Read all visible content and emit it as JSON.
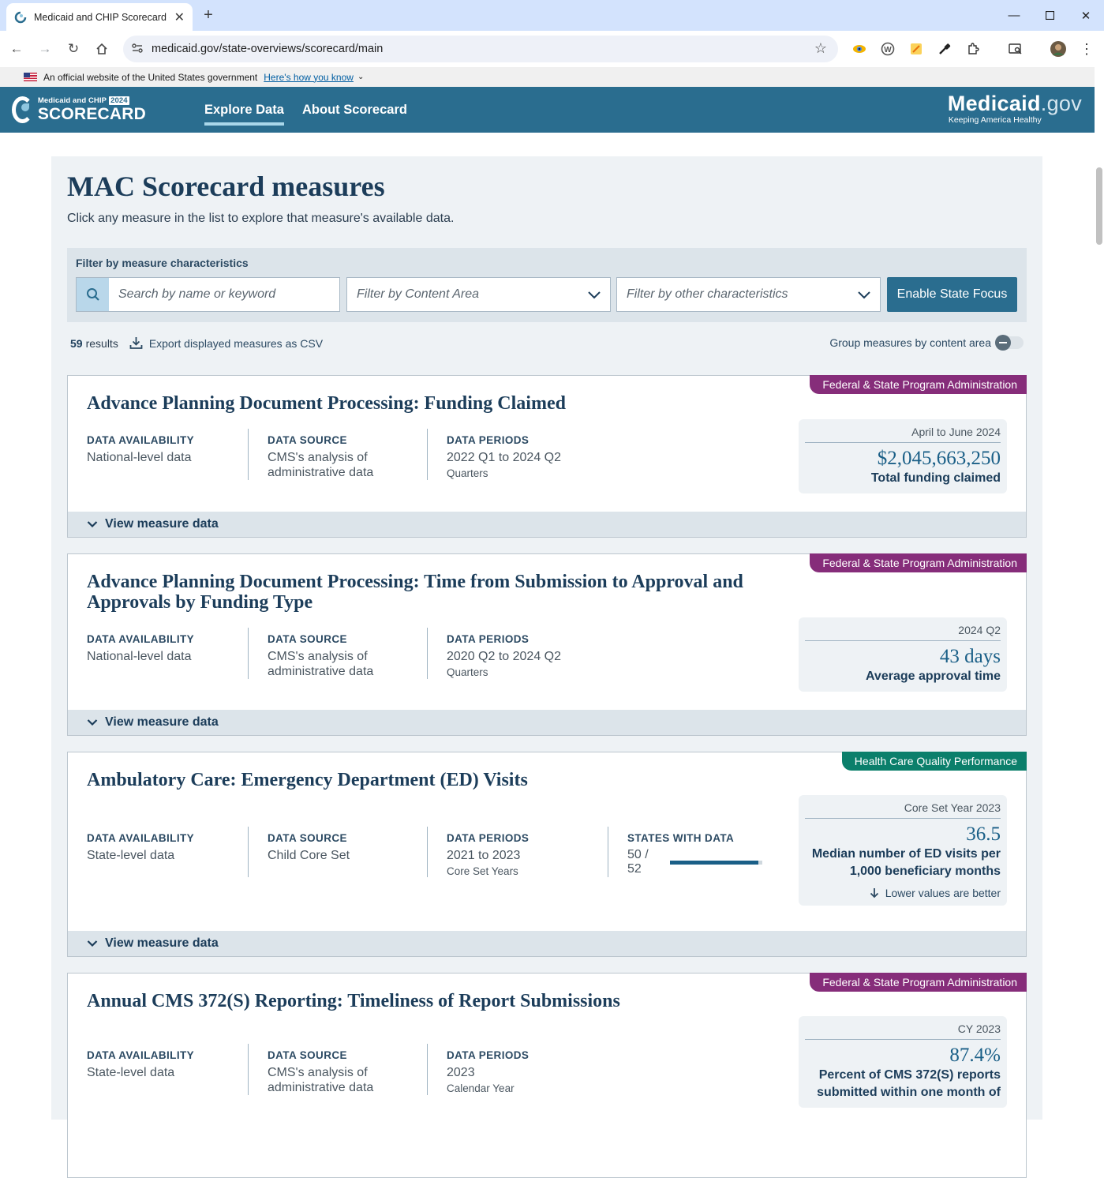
{
  "browser": {
    "tab_title": "Medicaid and CHIP Scorecard -",
    "url": "medicaid.gov/state-overviews/scorecard/main"
  },
  "gov_banner": {
    "text": "An official website of the United States government",
    "link": "Here's how you know"
  },
  "header": {
    "logo_small": "Medicaid and CHIP",
    "logo_year": "2024",
    "logo_big": "SCORECARD",
    "nav": [
      "Explore Data",
      "About Scorecard"
    ],
    "brand_main": "Medicaid",
    "brand_suffix": ".gov",
    "brand_tagline": "Keeping America Healthy"
  },
  "page": {
    "title": "MAC Scorecard measures",
    "subtitle": "Click any measure in the list to explore that measure's available data."
  },
  "filters": {
    "label": "Filter by measure characteristics",
    "search_placeholder": "Search by name or keyword",
    "content_area": "Filter by Content Area",
    "other": "Filter by other characteristics",
    "enable_button": "Enable State Focus"
  },
  "results": {
    "count": "59",
    "count_label": "results",
    "export": "Export displayed measures as CSV",
    "group_label": "Group measures by content area"
  },
  "labels": {
    "availability": "DATA AVAILABILITY",
    "source": "DATA SOURCE",
    "periods": "DATA PERIODS",
    "states": "STATES WITH DATA",
    "view": "View measure data",
    "lower_better": "Lower values are better"
  },
  "colors": {
    "fed_badge": "#862d7a",
    "hcq_badge": "#0b7f6b",
    "header_bg": "#2a6d8f"
  },
  "cards": [
    {
      "badge": "Federal & State Program Administration",
      "title": "Advance Planning Document Processing: Funding Claimed",
      "availability": "National-level data",
      "source": "CMS's analysis of administrative data",
      "periods": "2022 Q1 to 2024 Q2",
      "period_unit": "Quarters",
      "stat_period": "April to June 2024",
      "stat_value": "$2,045,663,250",
      "stat_desc": "Total funding claimed"
    },
    {
      "badge": "Federal & State Program Administration",
      "title": "Advance Planning Document Processing: Time from Submission to Approval and Approvals by Funding Type",
      "availability": "National-level data",
      "source": "CMS's analysis of administrative data",
      "periods": "2020 Q2 to 2024 Q2",
      "period_unit": "Quarters",
      "stat_period": "2024 Q2",
      "stat_value": "43 days",
      "stat_desc": "Average approval time"
    },
    {
      "badge": "Health Care Quality Performance",
      "title": "Ambulatory Care: Emergency Department (ED) Visits",
      "availability": "State-level data",
      "source": "Child Core Set",
      "periods": "2021 to 2023",
      "period_unit": "Core Set Years",
      "states": "50 / 52",
      "states_fraction": 0.9615,
      "stat_period": "Core Set Year 2023",
      "stat_value": "36.5",
      "stat_desc": "Median number of ED visits per 1,000 beneficiary months"
    },
    {
      "badge": "Federal & State Program Administration",
      "title": "Annual CMS 372(S) Reporting: Timeliness of Report Submissions",
      "availability": "State-level data",
      "source": "CMS's analysis of administrative data",
      "periods": "2023",
      "period_unit": "Calendar Year",
      "stat_period": "CY 2023",
      "stat_value": "87.4%",
      "stat_desc": "Percent of CMS 372(S) reports submitted within one month of"
    }
  ]
}
